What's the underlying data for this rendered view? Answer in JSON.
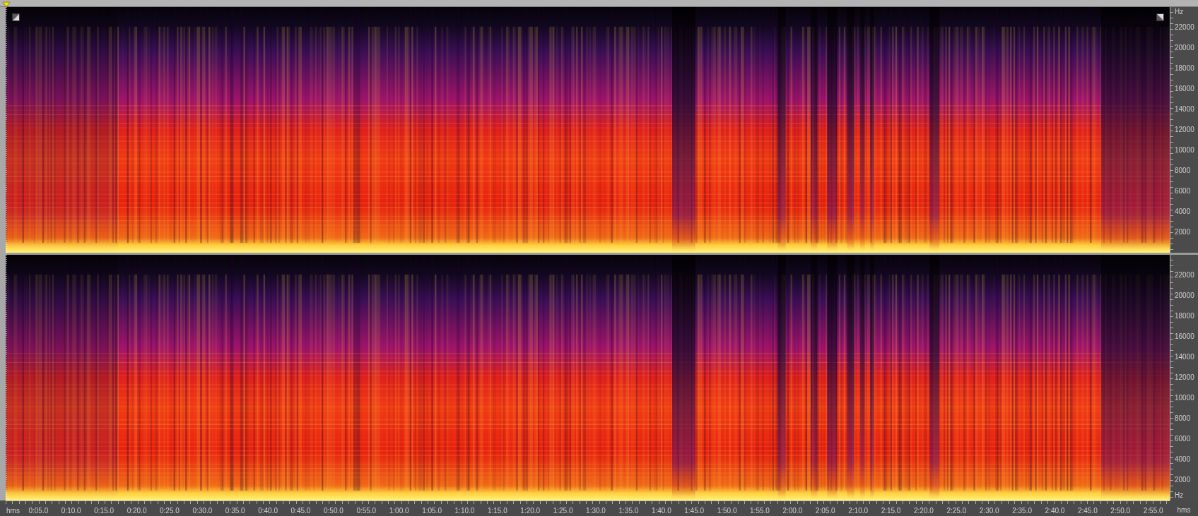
{
  "channels": [
    {
      "unit_top": "Hz",
      "corner_handles": true,
      "freq_labels": [
        "22000",
        "20000",
        "18000",
        "16000",
        "14000",
        "12000",
        "10000",
        "8000",
        "6000",
        "4000",
        "2000"
      ]
    },
    {
      "unit_bottom": "Hz",
      "corner_handles": false,
      "freq_labels": [
        "22000",
        "20000",
        "18000",
        "16000",
        "14000",
        "12000",
        "10000",
        "8000",
        "6000",
        "4000",
        "2000"
      ]
    }
  ],
  "time_axis": {
    "unit_left": "hms",
    "unit_right": "hms",
    "labels": [
      "0:05.0",
      "0:10.0",
      "0:15.0",
      "0:20.0",
      "0:25.0",
      "0:30.0",
      "0:35.0",
      "0:40.0",
      "0:45.0",
      "0:50.0",
      "0:55.0",
      "1:00.0",
      "1:05.0",
      "1:10.0",
      "1:15.0",
      "1:20.0",
      "1:25.0",
      "1:30.0",
      "1:35.0",
      "1:40.0",
      "1:45.0",
      "1:50.0",
      "1:55.0",
      "2:00.0",
      "2:05.0",
      "2:10.0",
      "2:15.0",
      "2:20.0",
      "2:25.0",
      "2:30.0",
      "2:35.0",
      "2:40.0",
      "2:45.0",
      "2:50.0",
      "2:55.0"
    ]
  }
}
